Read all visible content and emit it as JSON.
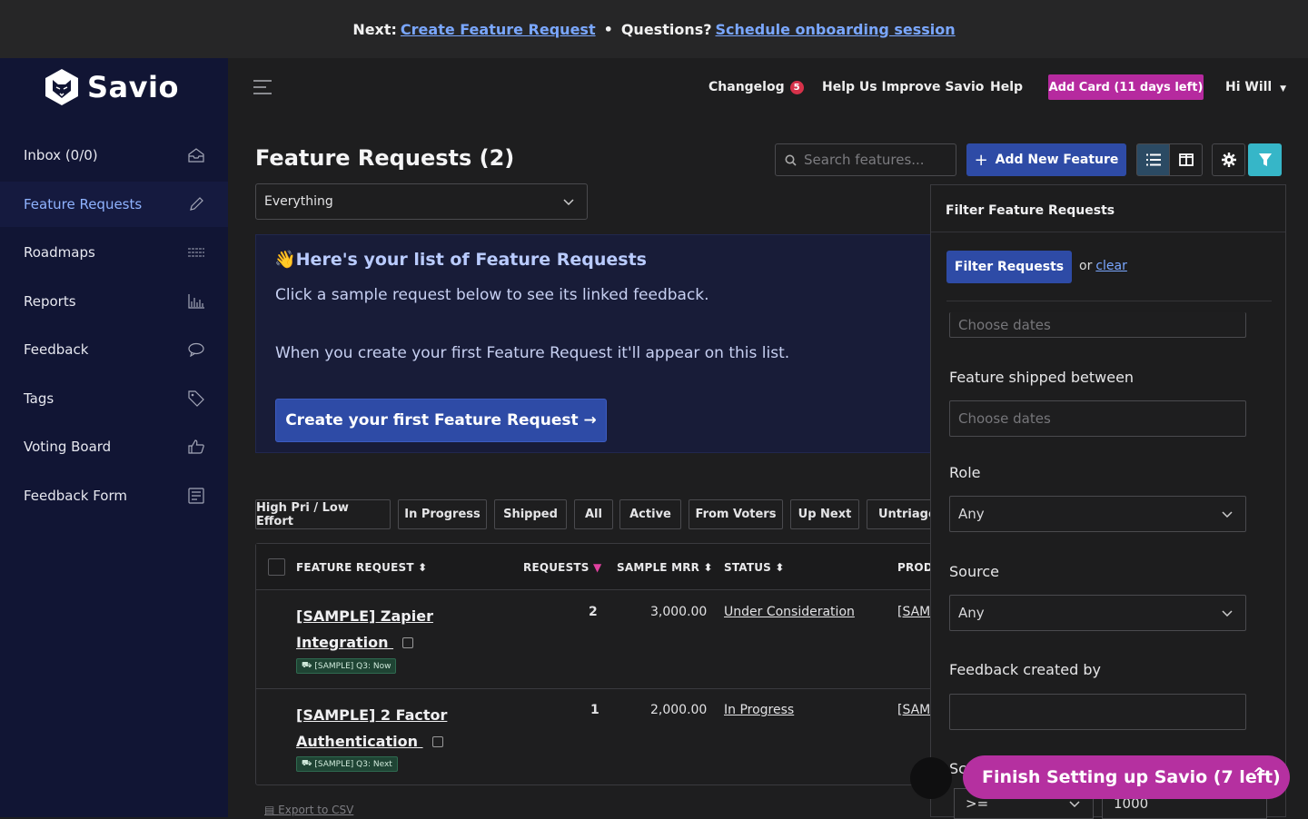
{
  "banner": {
    "next_label": "Next:",
    "next_link": "Create Feature Request",
    "separator": "•",
    "questions_label": "Questions?",
    "questions_link": "Schedule onboarding session"
  },
  "brand": {
    "name": "Savio"
  },
  "sidebar": {
    "items": [
      {
        "label": "Inbox (0/0)",
        "icon": "inbox-icon"
      },
      {
        "label": "Feature Requests",
        "icon": "pencil-icon"
      },
      {
        "label": "Roadmaps",
        "icon": "roadmap-icon"
      },
      {
        "label": "Reports",
        "icon": "chart-icon"
      },
      {
        "label": "Feedback",
        "icon": "chat-icon"
      },
      {
        "label": "Tags",
        "icon": "tag-icon"
      },
      {
        "label": "Voting Board",
        "icon": "thumbs-up-icon"
      },
      {
        "label": "Feedback Form",
        "icon": "form-icon"
      }
    ]
  },
  "header": {
    "changelog": "Changelog",
    "changelog_badge": "5",
    "help_improve": "Help Us Improve Savio",
    "help": "Help",
    "add_card": "Add Card (11 days left)",
    "user": "Hi Will"
  },
  "main": {
    "title": "Feature Requests (2)",
    "search_placeholder": "Search features...",
    "add_new": "Add New Feature",
    "view_select": "Everything"
  },
  "info": {
    "heading": "👋Here's your list of Feature Requests",
    "line1": "Click a sample request below to see its linked feedback.",
    "line2": "When you create your first Feature Request it'll appear on this list.",
    "cta": "Create your first Feature Request →"
  },
  "filter_tabs": [
    "High Pri / Low Effort",
    "In Progress",
    "Shipped",
    "All",
    "Active",
    "From Voters",
    "Up Next",
    "Untriage"
  ],
  "table": {
    "columns": [
      "FEATURE REQUEST",
      "REQUESTS",
      "SAMPLE MRR",
      "STATUS",
      "PROD"
    ],
    "rows": [
      {
        "title": "[SAMPLE] Zapier Integration",
        "tag": "[SAMPLE] Q3: Now",
        "requests": "2",
        "mrr": "3,000.00",
        "status": "Under Consideration",
        "product": "[SAM"
      },
      {
        "title": "[SAMPLE] 2 Factor Authentication",
        "tag": "[SAMPLE] Q3: Next",
        "requests": "1",
        "mrr": "2,000.00",
        "status": "In Progress",
        "product": "[SAM"
      }
    ],
    "export": "Export to CSV"
  },
  "filter_panel": {
    "title": "Filter Feature Requests",
    "apply": "Filter Requests",
    "or": "or",
    "clear": "clear",
    "choose_dates_top": "Choose dates",
    "shipped_label": "Feature shipped between",
    "shipped_placeholder": "Choose dates",
    "role_label": "Role",
    "role_value": "Any",
    "source_label": "Source",
    "source_value": "Any",
    "created_by_label": "Feedback created by",
    "created_by_value": "",
    "partial_label": "Sc",
    "operator_value": ">=",
    "amount_value": "1000"
  },
  "finish_setup": {
    "label": "Finish Setting up Savio (7 left)",
    "caret": "^"
  },
  "colors": {
    "accent": "#2e4ba6",
    "brand_pink": "#b62a9f",
    "sidebar_bg": "#111534",
    "link": "#7aa7ff",
    "filter_active": "#36b6c8"
  }
}
